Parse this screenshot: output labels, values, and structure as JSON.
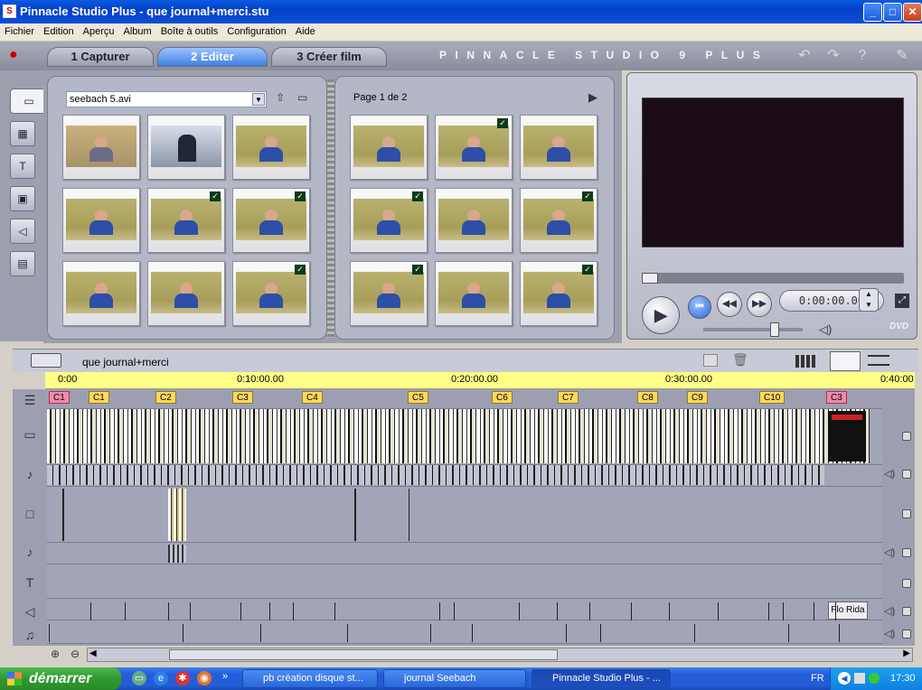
{
  "window": {
    "title": "Pinnacle Studio Plus - que journal+merci.stu",
    "min": "_",
    "max": "□",
    "close": "✕"
  },
  "menu": [
    "Fichier",
    "Edition",
    "Aperçu",
    "Album",
    "Boîte à outils",
    "Configuration",
    "Aide"
  ],
  "tabs": [
    {
      "label": "1 Capturer",
      "active": false
    },
    {
      "label": "2 Editer",
      "active": true
    },
    {
      "label": "3 Créer film",
      "active": false
    }
  ],
  "brand": "PINNACLE STUDIO 9 PLUS",
  "album": {
    "source_file": "seebach 5.avi",
    "page_label": "Page 1 de 2",
    "left_checked": [
      false,
      false,
      false,
      false,
      true,
      true,
      false,
      false,
      true
    ],
    "right_checked": [
      false,
      true,
      false,
      true,
      false,
      true,
      true,
      false,
      true
    ]
  },
  "player": {
    "timecode": "0:00:00.00",
    "dvd_label": "DVD"
  },
  "timeline": {
    "project_name": "que journal+merci",
    "ruler": [
      "0:00",
      "0:10:00.00",
      "0:20:00.00",
      "0:30:00.00",
      "0:40:00"
    ],
    "markers": [
      {
        "label": "C1",
        "color": "pink"
      },
      {
        "label": "C1",
        "color": "yellow"
      },
      {
        "label": "C2",
        "color": "yellow"
      },
      {
        "label": "C3",
        "color": "yellow"
      },
      {
        "label": "C4",
        "color": "yellow"
      },
      {
        "label": "C5",
        "color": "yellow"
      },
      {
        "label": "C6",
        "color": "yellow"
      },
      {
        "label": "C7",
        "color": "yellow"
      },
      {
        "label": "C8",
        "color": "yellow"
      },
      {
        "label": "C9",
        "color": "yellow"
      },
      {
        "label": "C10",
        "color": "yellow"
      },
      {
        "label": "C3",
        "color": "pink"
      }
    ],
    "clip_label": "Flo Rida"
  },
  "taskbar": {
    "start": "démarrer",
    "tasks": [
      "pb création disque st...",
      "journal Seebach",
      "Pinnacle Studio Plus - ..."
    ],
    "lang": "FR",
    "clock": "17:30"
  }
}
